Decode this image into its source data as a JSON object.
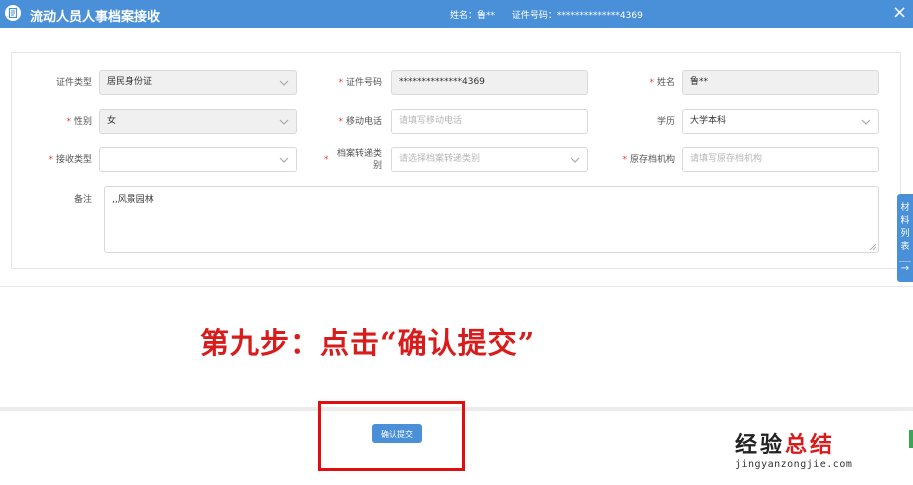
{
  "window": {
    "title": "流动人员人事档案接收",
    "name_info": "姓名：鲁**",
    "id_info": "证件号码：**************4369",
    "close_symbol": "×"
  },
  "form": {
    "id_type": {
      "label": "证件类型",
      "value": "居民身份证"
    },
    "id_number": {
      "label": "证件号码",
      "value": "**************4369"
    },
    "name": {
      "label": "姓名",
      "value": "鲁**"
    },
    "gender": {
      "label": "性别",
      "value": "女"
    },
    "mobile": {
      "label": "移动电话",
      "placeholder": "请填写移动电话"
    },
    "education": {
      "label": "学历",
      "value": "大学本科"
    },
    "receive_type": {
      "label": "接收类型",
      "value": ""
    },
    "transfer_type": {
      "label_line1": "档案转递类",
      "label_line2": "别",
      "placeholder": "请选择档案转递类别"
    },
    "original_org": {
      "label": "原存档机构",
      "placeholder": "请填写原存档机构"
    },
    "remarks": {
      "label": "备注",
      "value": ",,风景园林"
    },
    "required_mark": "*"
  },
  "side_tab": {
    "label_chars": [
      "材",
      "料",
      "列",
      "表"
    ],
    "arrow": "→"
  },
  "instruction_text": "第九步：点击“确认提交”",
  "submit_button": {
    "label": "确认提交"
  },
  "watermark": {
    "cn_part1": "经验",
    "cn_part2": "总结",
    "en": "jingyanzongjie.com"
  },
  "colors": {
    "accent": "#4a90d9",
    "required": "#e64040",
    "highlight": "#e00e0e"
  }
}
